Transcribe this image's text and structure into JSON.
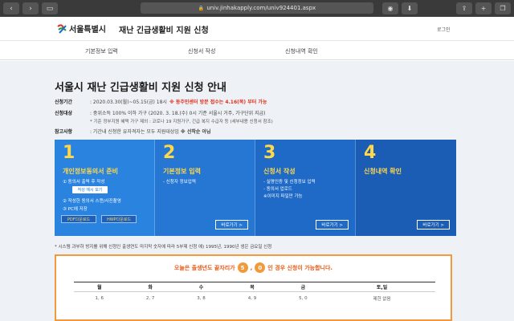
{
  "browser": {
    "url": "univ.jinhakapply.com/univ924401.aspx",
    "back_icon": "chevron-left-icon",
    "forward_icon": "chevron-right-icon"
  },
  "header": {
    "logo_text": "서울특별시",
    "title": "재난 긴급생활비 지원 신청",
    "login": "로그인"
  },
  "nav": {
    "items": [
      "기본정보 입력",
      "신청서 작성",
      "신청내역 확인"
    ]
  },
  "main": {
    "title": "서울시 재난 긴급생활비 지원 신청 안내",
    "period_label": "신청기간",
    "period_value": ": 2020.03.30(월)~05.15(금) 18시",
    "period_note": "※ 동주민센터 방문 접수는 4.16(목) 부터 가능",
    "target_label": "신청대상",
    "target_value": ": 중위소득 100% 이하 가구 (2020. 3. 18.(수) 0시 기준 서울시 거주, 가구단위 지급)",
    "target_sub": "* 기준 정부지원 혜택 가구 제외 : 코로나 19 지원가구, 긴급 복지 수급자 등 (세부내용 신청서 참조)",
    "ref_label": "참고사항",
    "ref_value": ": 기간내 신청한 유자격자는 모두 지원대상임",
    "ref_note": "※ 선착순 아님"
  },
  "steps": [
    {
      "num": "1",
      "title": "개인정보동의서 준비",
      "lines": [
        "① 동의서 출력 후 작성",
        "② 작성한 동의서 스캔/사진촬영",
        "③ PC에 저장"
      ],
      "sample": "작성 예시 보기",
      "dl1": "PDF다운로드",
      "dl2": "HWP다운로드"
    },
    {
      "num": "2",
      "title": "기본정보 입력",
      "lines": [
        "- 신청자 정보입력"
      ],
      "more": "바로가기 >"
    },
    {
      "num": "3",
      "title": "신청서 작성",
      "lines": [
        "- 실명인증 및 신청정보 입력",
        "- 동의서 업로드",
        "  ※이미지 파일만 가능"
      ],
      "more": "바로가기 >"
    },
    {
      "num": "4",
      "title": "신청내역 확인",
      "lines": [],
      "more": "바로가기 >"
    }
  ],
  "notice": {
    "text": "* 시스템 과부하 방지를 위해 신청인 출생연도 마지막 숫자에 따라 5부제 신청   예) 1995년, 1990년 생은 금요일 신청"
  },
  "schedule": {
    "msg_before": "오늘은 출생년도 끝자리가",
    "digit1": "5",
    "comma": ",",
    "digit2": "0",
    "msg_after": "인 경우 신청이 가능합니다.",
    "headers": [
      "월",
      "화",
      "수",
      "목",
      "금",
      "토,일"
    ],
    "values": [
      "1, 6",
      "2, 7",
      "3, 8",
      "4, 9",
      "5, 0",
      "제한 없음"
    ]
  },
  "colors": {
    "step_title": "#ffd84a",
    "accent_orange": "#f29a3b",
    "alert_red": "#e0301e"
  }
}
